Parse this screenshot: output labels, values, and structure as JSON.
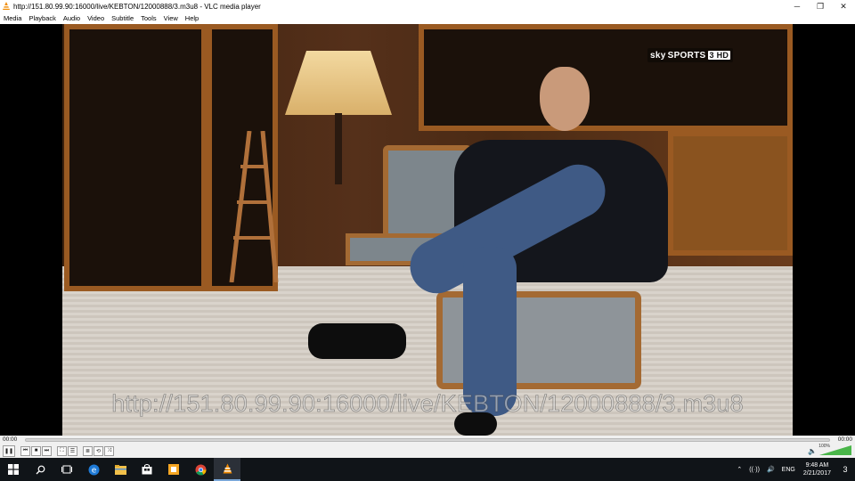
{
  "window": {
    "title": "http://151.80.99.90:16000/live/KEBTON/12000888/3.m3u8 - VLC media player",
    "minimize": "─",
    "maximize": "❐",
    "close": "✕"
  },
  "menu": [
    {
      "label": "Media"
    },
    {
      "label": "Playback"
    },
    {
      "label": "Audio"
    },
    {
      "label": "Video"
    },
    {
      "label": "Subtitle"
    },
    {
      "label": "Tools"
    },
    {
      "label": "View"
    },
    {
      "label": "Help"
    }
  ],
  "video": {
    "channel_logo": {
      "brand": "sky",
      "name": "SPORTS",
      "badge": "3 HD"
    },
    "overlay_url": "http://151.80.99.90:16000/live/KEBTON/12000888/3.m3u8"
  },
  "playback": {
    "elapsed": "00:00",
    "remaining": "00:00",
    "progress": 0
  },
  "controls": {
    "pause": "❚❚",
    "prev": "⏮",
    "stop": "■",
    "next": "⏭",
    "fullscreen": "⛶",
    "extended": "☰",
    "playlist": "≣",
    "loop": "⟲",
    "random": "⤨",
    "volume_icon": "🔈",
    "volume_percent": "100%",
    "volume_level": 1.0
  },
  "taskbar": {
    "icons": [
      "start-icon",
      "search-icon",
      "task-view-icon",
      "edge-icon",
      "file-explorer-icon",
      "store-icon",
      "office-icon",
      "chrome-icon",
      "vlc-icon"
    ],
    "tray": {
      "chevron": "⌃",
      "wifi": "((·))",
      "volume": "🔊",
      "language": "ENG",
      "time": "9:48 AM",
      "date": "2/21/2017",
      "notifications_count": "3"
    }
  },
  "colors": {
    "accent": "#4ab64a",
    "vlc_orange": "#f08a00",
    "taskbar": "#101418"
  }
}
